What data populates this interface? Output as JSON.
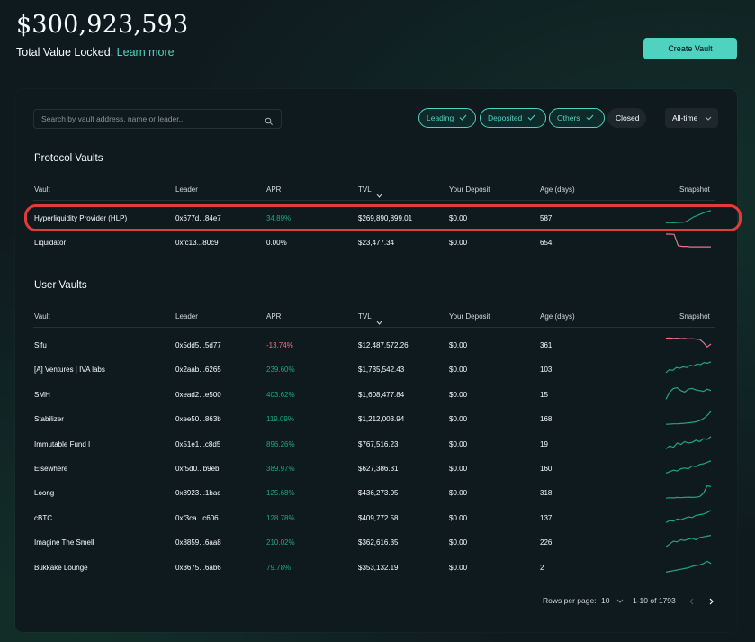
{
  "header": {
    "tvl_amount": "$300,923,593",
    "tvl_label": "Total Value Locked.",
    "learn_more": "Learn more",
    "create_vault": "Create Vault"
  },
  "search": {
    "placeholder": "Search by vault address, name or leader..."
  },
  "filters": [
    {
      "label": "Leading",
      "checked": true
    },
    {
      "label": "Deposited",
      "checked": true
    },
    {
      "label": "Others",
      "checked": true
    },
    {
      "label": "Closed",
      "checked": false
    }
  ],
  "time_range": "All-time",
  "columns": [
    "Vault",
    "Leader",
    "APR",
    "TVL",
    "Your Deposit",
    "Age (days)",
    "Snapshot"
  ],
  "protocol_section": {
    "title": "Protocol Vaults",
    "rows": [
      {
        "vault": "Hyperliquidity Provider (HLP)",
        "leader": "0x677d...84e7",
        "apr": "34.89%",
        "apr_sign": "pos",
        "tvl": "$269,890,899.01",
        "deposit": "$0.00",
        "age": "587",
        "trend": [
          0.1,
          0.12,
          0.1,
          0.12,
          0.13,
          0.14,
          0.2,
          0.35,
          0.5,
          0.6,
          0.7,
          0.8,
          0.88,
          0.95
        ]
      },
      {
        "vault": "Liquidator",
        "leader": "0xfc13...80c9",
        "apr": "0.00%",
        "apr_sign": "neutral",
        "tvl": "$23,477.34",
        "deposit": "$0.00",
        "age": "654",
        "trend": [
          1,
          1,
          0.98,
          0.2,
          0.15,
          0.15,
          0.12,
          0.12,
          0.12,
          0.12,
          0.12,
          0.12
        ]
      }
    ]
  },
  "user_section": {
    "title": "User Vaults",
    "rows": [
      {
        "vault": "Sifu",
        "leader": "0x5dd5...5d77",
        "apr": "-13.74%",
        "apr_sign": "neg",
        "tvl": "$12,487,572.26",
        "deposit": "$0.00",
        "age": "361",
        "trend": [
          0.9,
          0.92,
          0.88,
          0.9,
          0.87,
          0.88,
          0.85,
          0.86,
          0.84,
          0.82,
          0.6,
          0.3,
          0.5
        ]
      },
      {
        "vault": "[A] Ventures | IVA labs",
        "leader": "0x2aab...6265",
        "apr": "239.60%",
        "apr_sign": "pos",
        "tvl": "$1,735,542.43",
        "deposit": "$0.00",
        "age": "103",
        "trend": [
          0.2,
          0.4,
          0.35,
          0.55,
          0.5,
          0.6,
          0.55,
          0.7,
          0.65,
          0.8,
          0.75,
          0.9,
          0.85,
          0.95
        ]
      },
      {
        "vault": "SMH",
        "leader": "0xead2...e500",
        "apr": "403.62%",
        "apr_sign": "pos",
        "tvl": "$1,608,477.84",
        "deposit": "$0.00",
        "age": "15",
        "trend": [
          0.1,
          0.6,
          0.85,
          0.9,
          0.7,
          0.6,
          0.8,
          0.85,
          0.75,
          0.7,
          0.65,
          0.8,
          0.7
        ]
      },
      {
        "vault": "Stabilizer",
        "leader": "0xee50...863b",
        "apr": "119.09%",
        "apr_sign": "pos",
        "tvl": "$1,212,003.94",
        "deposit": "$0.00",
        "age": "168",
        "trend": [
          0.05,
          0.06,
          0.08,
          0.08,
          0.1,
          0.12,
          0.15,
          0.18,
          0.22,
          0.3,
          0.45,
          0.65,
          0.95
        ]
      },
      {
        "vault": "Immutable Fund I",
        "leader": "0x51e1...c8d5",
        "apr": "896.26%",
        "apr_sign": "pos",
        "tvl": "$767,516.23",
        "deposit": "$0.00",
        "age": "19",
        "trend": [
          0.1,
          0.3,
          0.2,
          0.5,
          0.4,
          0.6,
          0.5,
          0.55,
          0.7,
          0.6,
          0.8,
          0.75,
          0.95
        ]
      },
      {
        "vault": "Elsewhere",
        "leader": "0xf5d0...b9eb",
        "apr": "389.97%",
        "apr_sign": "pos",
        "tvl": "$627,386.31",
        "deposit": "$0.00",
        "age": "160",
        "trend": [
          0.1,
          0.2,
          0.3,
          0.25,
          0.4,
          0.45,
          0.4,
          0.6,
          0.55,
          0.7,
          0.75,
          0.85,
          0.95
        ]
      },
      {
        "vault": "Loong",
        "leader": "0x8923...1bac",
        "apr": "125.68%",
        "apr_sign": "pos",
        "tvl": "$436,273.05",
        "deposit": "$0.00",
        "age": "318",
        "trend": [
          0.05,
          0.08,
          0.06,
          0.1,
          0.08,
          0.1,
          0.12,
          0.1,
          0.12,
          0.15,
          0.4,
          0.9,
          0.85
        ]
      },
      {
        "vault": "cBTC",
        "leader": "0xf3ca...c606",
        "apr": "128.78%",
        "apr_sign": "pos",
        "tvl": "$409,772.58",
        "deposit": "$0.00",
        "age": "137",
        "trend": [
          0.1,
          0.25,
          0.2,
          0.35,
          0.3,
          0.4,
          0.5,
          0.45,
          0.6,
          0.65,
          0.7,
          0.8,
          0.95
        ]
      },
      {
        "vault": "Imagine The Smell",
        "leader": "0x8859...6aa8",
        "apr": "210.02%",
        "apr_sign": "pos",
        "tvl": "$362,616.35",
        "deposit": "$0.00",
        "age": "226",
        "trend": [
          0.1,
          0.3,
          0.5,
          0.45,
          0.6,
          0.55,
          0.65,
          0.7,
          0.6,
          0.75,
          0.8,
          0.85,
          0.9
        ]
      },
      {
        "vault": "Bukkake Lounge",
        "leader": "0x3675...6ab6",
        "apr": "79.78%",
        "apr_sign": "pos",
        "tvl": "$353,132.19",
        "deposit": "$0.00",
        "age": "2",
        "trend": [
          0.1,
          0.15,
          0.2,
          0.25,
          0.3,
          0.35,
          0.4,
          0.5,
          0.55,
          0.6,
          0.7,
          0.85,
          0.7
        ]
      }
    ]
  },
  "pagination": {
    "rows_per_page_label": "Rows per page:",
    "rows_per_page": "10",
    "range": "1-10 of 1793"
  },
  "colors": {
    "accent": "#50d2c1",
    "positive": "#1fa67d",
    "negative": "#ed7088",
    "highlight": "#e23b3b"
  }
}
